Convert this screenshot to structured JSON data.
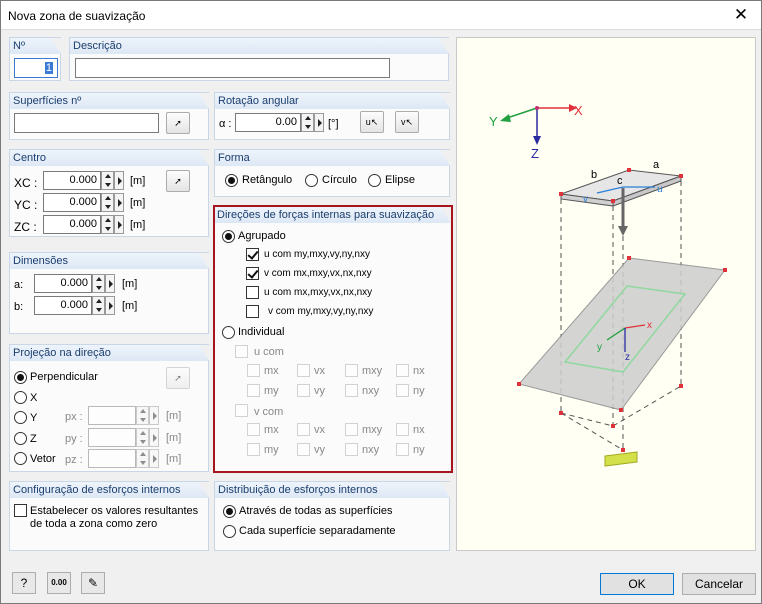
{
  "window": {
    "title": "Nova zona de suavização"
  },
  "no": {
    "label": "Nº",
    "value": "1"
  },
  "descricao": {
    "label": "Descrição",
    "value": ""
  },
  "superficies": {
    "label": "Superfícies nº",
    "value": ""
  },
  "rotacao": {
    "label": "Rotação angular",
    "alpha": "α :",
    "value": "0.00",
    "unit": "[°]",
    "btn_u": "u",
    "btn_v": "v"
  },
  "centro": {
    "label": "Centro",
    "rows": [
      {
        "sym": "XC :",
        "value": "0.000",
        "unit": "[m]"
      },
      {
        "sym": "YC :",
        "value": "0.000",
        "unit": "[m]"
      },
      {
        "sym": "ZC :",
        "value": "0.000",
        "unit": "[m]"
      }
    ]
  },
  "forma": {
    "label": "Forma",
    "options": [
      "Retângulo",
      "Círculo",
      "Elipse"
    ],
    "selected": "Retângulo"
  },
  "dimensoes": {
    "label": "Dimensões",
    "rows": [
      {
        "sym": "a:",
        "value": "0.000",
        "unit": "[m]"
      },
      {
        "sym": "b:",
        "value": "0.000",
        "unit": "[m]"
      }
    ]
  },
  "projecao": {
    "label": "Projeção na direção",
    "options": [
      "Perpendicular",
      "X",
      "Y",
      "Z",
      "Vetor"
    ],
    "selected": "Perpendicular",
    "fields": [
      {
        "sym": "px :",
        "unit": "[m]"
      },
      {
        "sym": "py :",
        "unit": "[m]"
      },
      {
        "sym": "pz :",
        "unit": "[m]"
      }
    ]
  },
  "direcoes": {
    "label": "Direções de forças internas para suavização",
    "agrupado": "Agrupado",
    "individual": "Individual",
    "group_items": [
      {
        "text": "u com my,mxy,vy,ny,nxy",
        "checked": true
      },
      {
        "text": "v com mx,mxy,vx,nx,nxy",
        "checked": true
      },
      {
        "text": "u com mx,mxy,vx,nx,nxy",
        "checked": false
      },
      {
        "text": "v com my,mxy,vy,ny,nxy",
        "checked": false
      }
    ],
    "u_com": "u com",
    "v_com": "v com",
    "grid": [
      "mx",
      "vx",
      "mxy",
      "nx",
      "my",
      "vy",
      "nxy",
      "ny"
    ]
  },
  "config": {
    "label": "Configuração de esforços internos",
    "check_text": "Estabelecer os valores resultantes de toda a zona como zero"
  },
  "distribuicao": {
    "label": "Distribuição de esforços internos",
    "options": [
      "Através de todas as superfícies",
      "Cada superfície separadamente"
    ],
    "selected": "Através de todas as superfícies"
  },
  "diagram": {
    "axes": [
      "X",
      "Y",
      "Z"
    ],
    "labels": [
      "a",
      "b",
      "c",
      "u",
      "v"
    ]
  },
  "buttons": {
    "ok": "OK",
    "cancel": "Cancelar",
    "tool3": "0.00"
  },
  "colors": {
    "header_text": "#1a3e6e",
    "highlight_border": "#a8141b",
    "axis_x": "#e0303a",
    "axis_y": "#20a040",
    "axis_z": "#2a2aa0"
  }
}
